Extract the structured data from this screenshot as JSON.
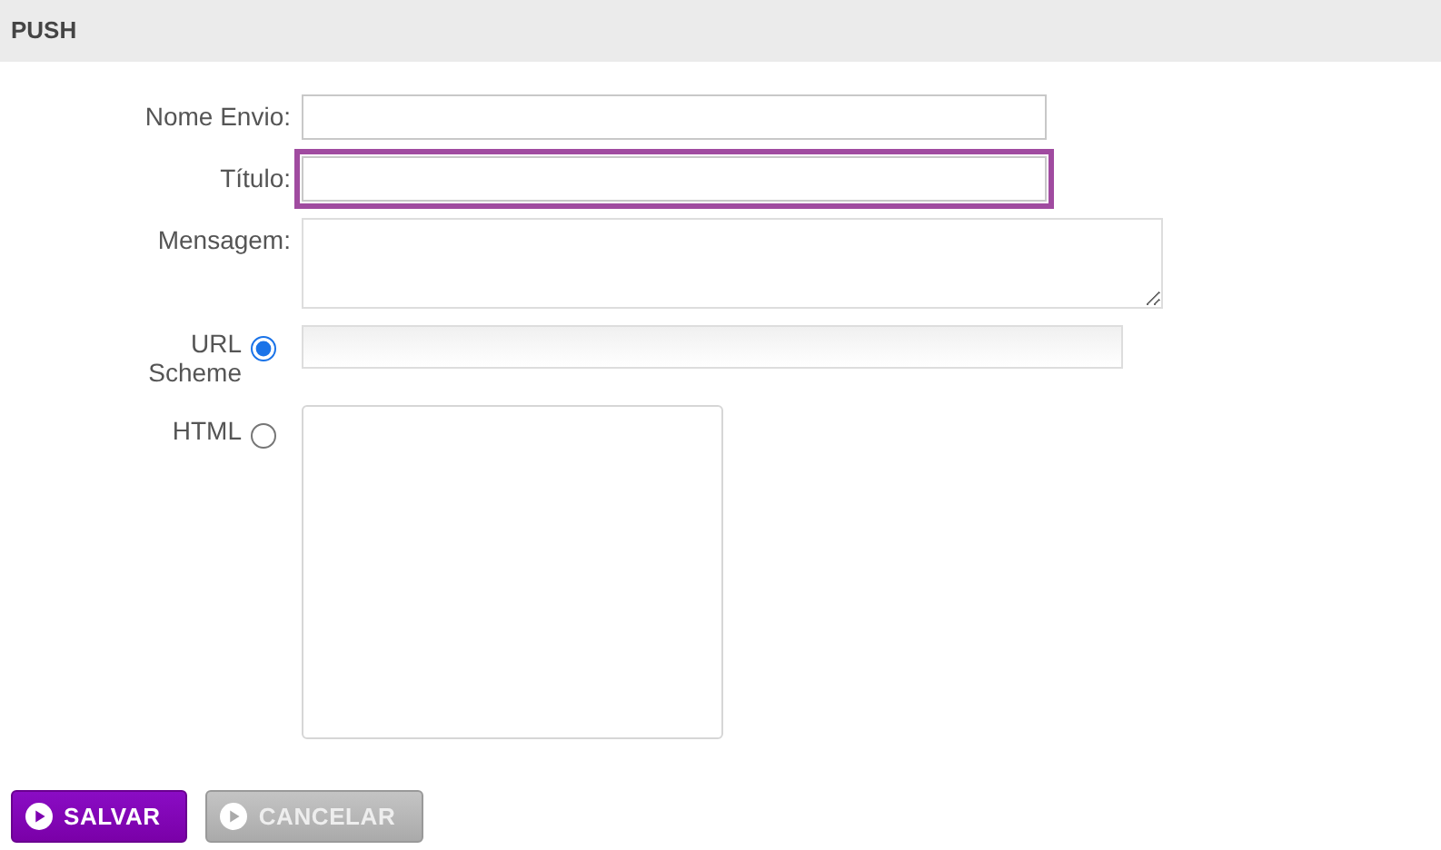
{
  "header": {
    "title": "PUSH"
  },
  "fields": [
    {
      "label": "Nome Envio:",
      "kind": "text",
      "focused": false
    },
    {
      "label": "Título:",
      "kind": "text",
      "focused": true
    },
    {
      "label": "Mensagem:",
      "kind": "textarea",
      "focused": false
    }
  ],
  "content_options": [
    {
      "label": "URL Scheme",
      "kind": "url",
      "selected": true
    },
    {
      "label": "HTML",
      "kind": "html",
      "selected": false
    }
  ],
  "buttons": [
    {
      "label": "SALVAR",
      "kind": "primary"
    },
    {
      "label": "CANCELAR",
      "kind": "secondary"
    }
  ]
}
